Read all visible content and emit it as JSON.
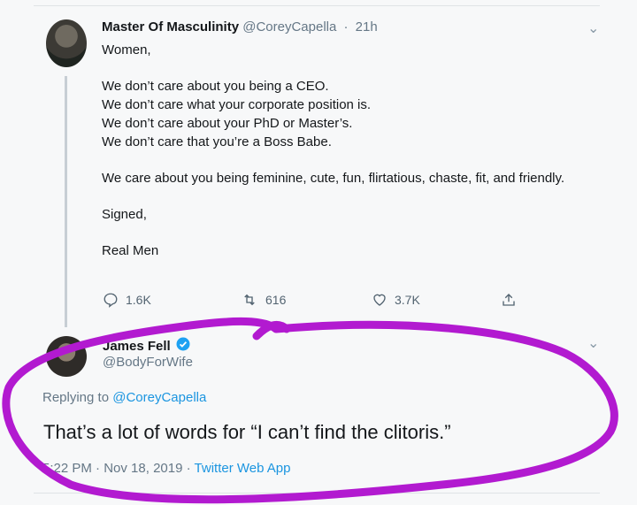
{
  "tweet1": {
    "name": "Master Of Masculinity",
    "handle": "@CoreyCapella",
    "time": "21h",
    "lines": {
      "l1": "Women,",
      "l2": "We don’t care about you being a CEO.",
      "l3": "We don’t care what your corporate position is.",
      "l4": "We don’t care about your PhD or Master’s.",
      "l5": "We don’t care that you’re a Boss Babe.",
      "l6": "We care about you being feminine, cute, fun, flirtatious, chaste, fit, and friendly.",
      "l7": "Signed,",
      "l8": "Real Men"
    },
    "replies": "1.6K",
    "retweets": "616",
    "likes": "3.7K"
  },
  "tweet2": {
    "name": "James Fell",
    "handle": "@BodyForWife",
    "replying_prefix": "Replying to",
    "replying_to": "@CoreyCapella",
    "text": "That’s a lot of words for “I can’t find the clitoris.”",
    "time": "5:22 PM",
    "date": "Nov 18, 2019",
    "app": "Twitter Web App"
  },
  "colors": {
    "annotation": "#b21ad0",
    "link": "#1b95e0",
    "muted": "#657786"
  }
}
